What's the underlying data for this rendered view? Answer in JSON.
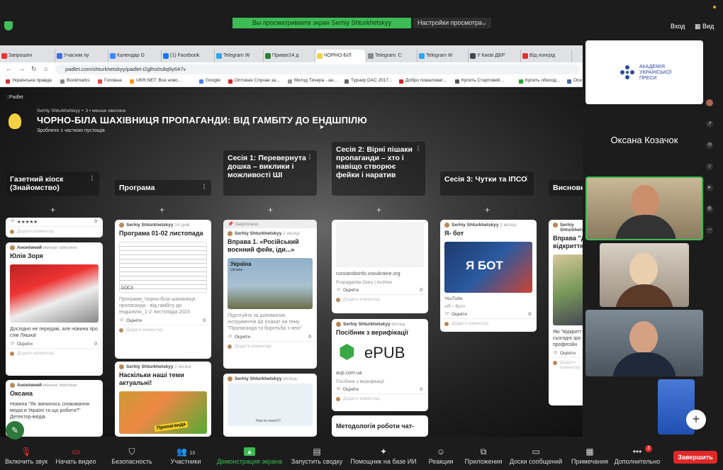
{
  "zoom": {
    "banner": "Вы просматриваете экран Serhiy Shturkhetskyy",
    "view_settings": "Настройки просмотра",
    "login": "Вход",
    "view": "Вид"
  },
  "browser": {
    "tabs": [
      "Запрошен",
      "Учасник пу",
      "Календар G",
      "(1) Facebook",
      "Telegram W",
      "Приват24 д",
      "ЧОРНО-БІЛ",
      "Telegram: C",
      "Telegram W",
      "У Києві ДБР",
      "Від лонгрід"
    ],
    "url": "padlet.com/shturkhetskyy/padlet-i2glho0s8q9y647v",
    "bookmarks": [
      "Українська правда",
      "Bookmarks",
      "Головна",
      "UKR.NET: Все ново...",
      "Google",
      "Оптовая Случае за...",
      "Метод Тичера - ан...",
      "Турнир DAC 2017...",
      "Добро пожаловат...",
      "Купить Стартовий...",
      "Купить обиход...",
      "Оси",
      "Закладки"
    ]
  },
  "padlet": {
    "logo": "::Padlet",
    "meta": "Serhiy Shturkhetskyy + 3 • менше хвилини",
    "title": "ЧОРНО-БІЛА ШАХІВНИЦЯ ПРОПАГАНДИ: ВІД ГАМБІТУ ДО ЕНДШПІЛЮ",
    "subtitle": "Зроблено з часткою пустощів",
    "columns": [
      "Газетний кіоск (Знайомство)",
      "Програма",
      "Сесія 1: Перевернута дошка – виклики і можливості ШІ",
      "Сесія 2: Вірні пішаки пропаганди – хто і навіщо створює фейки і наратив",
      "Сесія 3: Чутки та ІПСО",
      "Висновк"
    ],
    "rate": "Оцініти",
    "add_comment": "Додати коментар",
    "pinned": "Закріплено",
    "col1": {
      "c1_author": "Анонімний",
      "c1_time": "менше хвилини",
      "c1_title": "Юлія Зоря",
      "c1_text": "Дослідно не передам, але новина про спів Ляшка!",
      "c2_author": "Анонімний",
      "c2_time": "менше хвилини",
      "c2_title": "Оксана",
      "c2_text": "Новина \"Як змінилось споживання медіа в Україні та що робити?\" Детектор-медіа",
      "top_count": "0"
    },
    "col2": {
      "c1_author": "Serhiy Shturkhetskyy",
      "c1_time": "14 днів",
      "c1_title": "Програма 01-02 листопада",
      "c1_tag": "DOCX",
      "c1_desc": "Програма_Чорно-біла шахівниця пропаганди - від гамбіту до ендшпілю_1-2 листопада 2023",
      "c2_author": "Serhiy Shturkhetskyy",
      "c2_time": "2 місяці",
      "c2_title": "Наскільки наші теми актуальні!",
      "c2_img": "Пропаганда"
    },
    "col3": {
      "c1_author": "Serhiy Shturkhetskyy",
      "c1_time": "2 місяці",
      "c1_title": "Вправа 1. «Російський воєнний фейк, іди...»",
      "c1_img": "Україна",
      "c1_img_sub": "Ukraine",
      "c1_text": "Підготуйте за допомогою інструментів ШІ плакат на тему \"Пропаганда та боротьба з нею\"",
      "c2_author": "Serhiy Shturkhetskyy",
      "c2_time": "місяць",
      "c2_img": "How to search?"
    },
    "col4": {
      "c1_site": "russiandisinfo.voxukraine.org",
      "c1_meta": "Propaganda Diary | Archive",
      "c2_author": "Serhiy Shturkhetskyy",
      "c2_time": "місяць",
      "c2_title": "Посібник з верифікації",
      "c2_logo": "ePUB",
      "c2_site": "aup.com.ua",
      "c2_meta": "Посібник з верифікації",
      "c3_title": "Методологія роботи чат-"
    },
    "col5": {
      "c1_author": "Serhiy Shturkhetskyy",
      "c1_time": "2 місяці",
      "c1_title": "Я- бот",
      "c1_img": "Я БОТ",
      "c1_src": "YouTube",
      "c1_sub": "«Я – бот»"
    },
    "col6": {
      "c1_author": "Serhiy Shturkhetskyy",
      "c1_title": "Вправа \"Д відкриття\"",
      "c1_text": "Які \"відкритт сьогодні зро 1) професійн"
    },
    "comment_count": "0"
  },
  "participants": {
    "logo_line1": "АКАДЕМІЯ",
    "logo_line2": "УКРАЇНСЬКОЇ",
    "logo_line3": "ПРЕСИ",
    "name_tile": "Оксана Козачок"
  },
  "toolbar": {
    "mute": "Включить звук",
    "video": "Начать видео",
    "security": "Безопасность",
    "participants": "Участники",
    "participants_count": "13",
    "share": "Демонстрация экрана",
    "record": "Запустить сводку",
    "assistant": "Помощник на базе ИИ",
    "reactions": "Реакции",
    "apps": "Приложения",
    "whiteboards": "Доски сообщений",
    "notes": "Примечания",
    "more": "Дополнительно",
    "more_badge": "3",
    "end": "Завершить"
  }
}
